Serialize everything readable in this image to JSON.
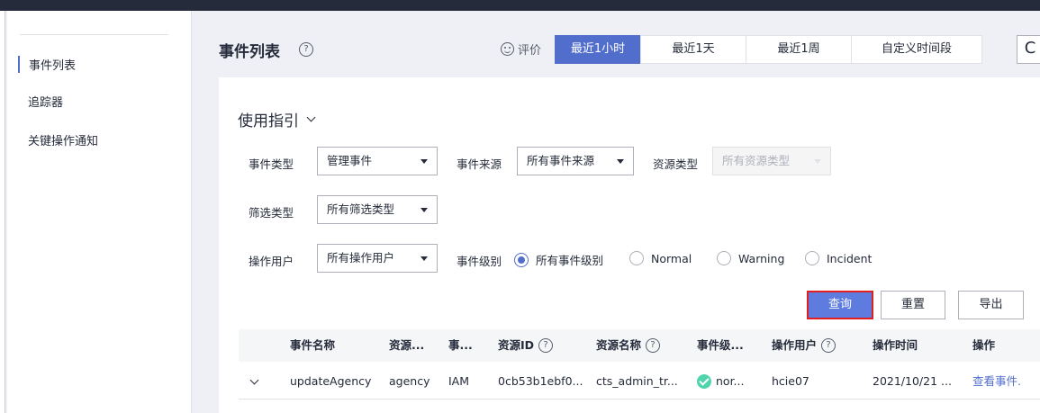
{
  "sidebar": {
    "items": [
      {
        "label": "事件列表",
        "active": true
      },
      {
        "label": "追踪器",
        "active": false
      },
      {
        "label": "关键操作通知",
        "active": false
      }
    ]
  },
  "header": {
    "title": "事件列表",
    "help": "?",
    "rating_label": "评价",
    "time_tabs": [
      {
        "label": "最近1小时",
        "active": true
      },
      {
        "label": "最近1天",
        "active": false
      },
      {
        "label": "最近1周",
        "active": false
      },
      {
        "label": "自定义时间段",
        "active": false
      }
    ],
    "refresh_icon": "C"
  },
  "filters": {
    "guide_label": "使用指引",
    "event_type": {
      "label": "事件类型",
      "value": "管理事件"
    },
    "event_source": {
      "label": "事件来源",
      "value": "所有事件来源"
    },
    "resource_type": {
      "label": "资源类型",
      "value": "所有资源类型"
    },
    "filter_type": {
      "label": "筛选类型",
      "value": "所有筛选类型"
    },
    "operator": {
      "label": "操作用户",
      "value": "所有操作用户"
    },
    "event_level": {
      "label": "事件级别",
      "options": [
        {
          "label": "所有事件级别",
          "checked": true
        },
        {
          "label": "Normal",
          "checked": false
        },
        {
          "label": "Warning",
          "checked": false
        },
        {
          "label": "Incident",
          "checked": false
        }
      ]
    },
    "buttons": {
      "query": "查询",
      "reset": "重置",
      "export": "导出"
    }
  },
  "table": {
    "columns": [
      "事件名称",
      "资源...",
      "事...",
      "资源ID",
      "资源名称",
      "事件级...",
      "操作用户",
      "操作时间",
      "操作"
    ],
    "rows": [
      {
        "event_name": "updateAgency",
        "resource_type": "agency",
        "source": "IAM",
        "resource_id": "0cb53b1ebf0...",
        "resource_name": "cts_admin_tr...",
        "level": "nor...",
        "operator": "hcie07",
        "time": "2021/10/21 ...",
        "action": "查看事件."
      }
    ]
  },
  "colors": {
    "accent": "#526ecc",
    "primary_button": "#5e7ce0",
    "highlight_border": "#e02020",
    "ok": "#50d4ab"
  }
}
